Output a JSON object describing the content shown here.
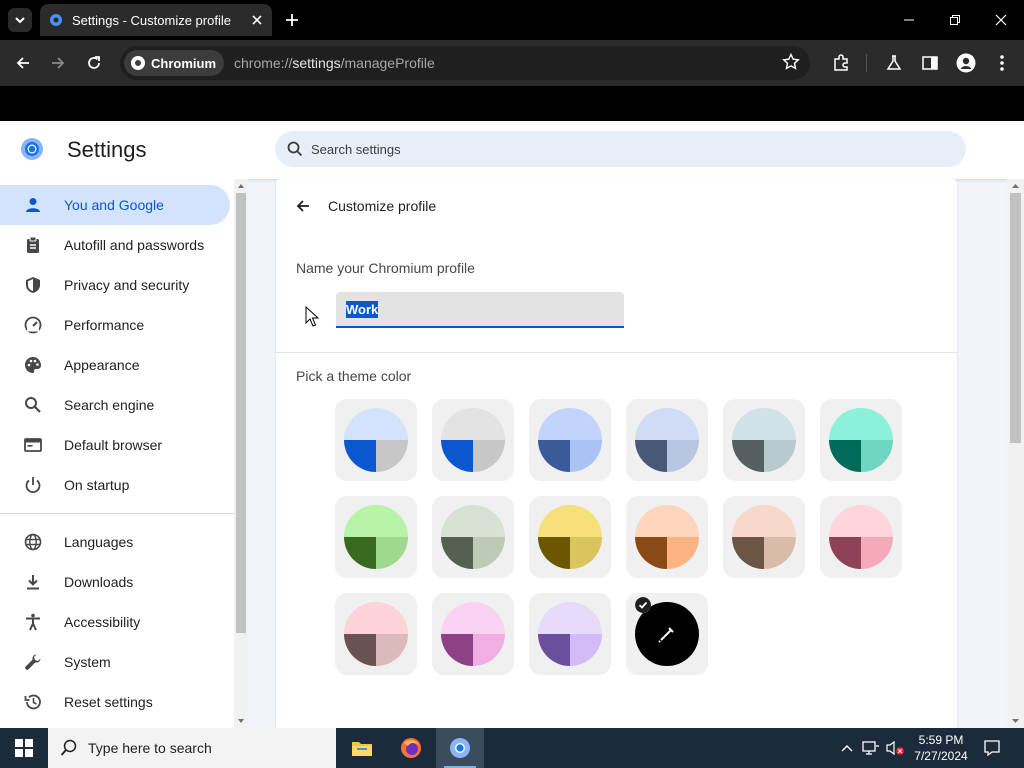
{
  "browser": {
    "tab_title": "Settings - Customize profile",
    "chip_label": "Chromium",
    "url_prefix": "chrome://",
    "url_host": "settings",
    "url_path": "/manageProfile"
  },
  "settings": {
    "title": "Settings",
    "search_placeholder": "Search settings",
    "nav": [
      {
        "label": "You and Google",
        "icon": "person-icon",
        "active": true
      },
      {
        "label": "Autofill and passwords",
        "icon": "clipboard-icon"
      },
      {
        "label": "Privacy and security",
        "icon": "shield-icon"
      },
      {
        "label": "Performance",
        "icon": "speedometer-icon"
      },
      {
        "label": "Appearance",
        "icon": "palette-icon"
      },
      {
        "label": "Search engine",
        "icon": "search-icon"
      },
      {
        "label": "Default browser",
        "icon": "browser-window-icon"
      },
      {
        "label": "On startup",
        "icon": "power-icon"
      },
      {
        "label": "Languages",
        "icon": "globe-icon"
      },
      {
        "label": "Downloads",
        "icon": "download-icon"
      },
      {
        "label": "Accessibility",
        "icon": "accessibility-icon"
      },
      {
        "label": "System",
        "icon": "wrench-icon"
      },
      {
        "label": "Reset settings",
        "icon": "reset-history-icon"
      }
    ]
  },
  "profile": {
    "header": "Customize profile",
    "name_label": "Name your Chromium profile",
    "name_value": "Work",
    "theme_label": "Pick a theme color",
    "themes": [
      {
        "top": "#d3e3fd",
        "left": "#0b57d0",
        "right": "#c7c7c7"
      },
      {
        "top": "#e3e3e3",
        "left": "#0b57d0",
        "right": "#c7c7c7"
      },
      {
        "top": "#c2d4fb",
        "left": "#3a5a9a",
        "right": "#a9c3f7"
      },
      {
        "top": "#d0dcf5",
        "left": "#4a5878",
        "right": "#b9c6e1"
      },
      {
        "top": "#d0e2e6",
        "left": "#545f63",
        "right": "#b7cbcf"
      },
      {
        "top": "#8df0d8",
        "left": "#006b58",
        "right": "#6fd6c1"
      },
      {
        "top": "#b7f2a7",
        "left": "#386a20",
        "right": "#9fd990"
      },
      {
        "top": "#d7e2d4",
        "left": "#556150",
        "right": "#bccab8"
      },
      {
        "top": "#f7df7a",
        "left": "#6c5700",
        "right": "#dac55d"
      },
      {
        "top": "#ffd5bd",
        "left": "#8a4a17",
        "right": "#fbb383"
      },
      {
        "top": "#f8d8c8",
        "left": "#6c5545",
        "right": "#d8bca9"
      },
      {
        "top": "#fed5dc",
        "left": "#8e4157",
        "right": "#f6a9b9"
      },
      {
        "top": "#fbd3d9",
        "left": "#6a5252",
        "right": "#dcbaba"
      },
      {
        "top": "#fbd3f2",
        "left": "#8b4183",
        "right": "#f0aee4"
      },
      {
        "top": "#e6dbfb",
        "left": "#6a4f9f",
        "right": "#d2bbf7"
      },
      {
        "custom": true,
        "color": "#000000",
        "icon": "eyedropper-icon",
        "selected": true
      }
    ]
  },
  "taskbar": {
    "search_placeholder": "Type here to search",
    "time": "5:59 PM",
    "date": "7/27/2024"
  }
}
